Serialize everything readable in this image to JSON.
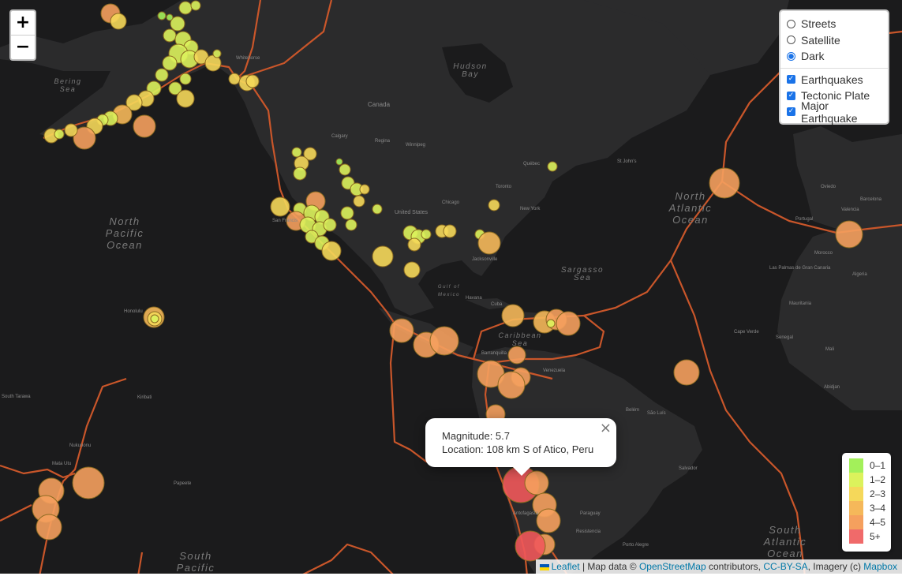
{
  "zoom": {
    "in_label": "+",
    "out_label": "−"
  },
  "layer_control": {
    "base_layers": [
      {
        "label": "Streets",
        "selected": false
      },
      {
        "label": "Satellite",
        "selected": false
      },
      {
        "label": "Dark",
        "selected": true
      }
    ],
    "overlays": [
      {
        "label": "Earthquakes",
        "checked": true
      },
      {
        "label": "Tectonic Plate",
        "checked": true
      },
      {
        "label": "Major Earthquake",
        "checked": true
      }
    ],
    "check_glyph": "✓"
  },
  "legend": {
    "items": [
      {
        "label": "0–1",
        "color": "#a3f05a"
      },
      {
        "label": "1–2",
        "color": "#dcf25c"
      },
      {
        "label": "2–3",
        "color": "#f5d85a"
      },
      {
        "label": "3–4",
        "color": "#f5b85a"
      },
      {
        "label": "4–5",
        "color": "#f5a05e"
      },
      {
        "label": "5+",
        "color": "#f06a6a"
      }
    ]
  },
  "popup": {
    "magnitude_line": "Magnitude: 5.7",
    "location_line": "Location: 108 km S of Atico, Peru",
    "close_glyph": "×"
  },
  "attribution": {
    "leaflet": "Leaflet",
    "sep1": " | Map data © ",
    "osm": "OpenStreetMap",
    "contributors": " contributors, ",
    "license": "CC-BY-SA",
    "imagery": ", Imagery (c) ",
    "mapbox": "Mapbox"
  },
  "map_labels": {
    "north_pacific": [
      "North",
      "Pacific",
      "Ocean"
    ],
    "north_atlantic": [
      "North",
      "Atlantic",
      "Ocean"
    ],
    "south_pacific": [
      "South",
      "Pacific"
    ],
    "south_atlantic": [
      "South",
      "Atlantic",
      "Ocean"
    ],
    "bering_sea": [
      "Bering",
      "Sea"
    ],
    "hudson_bay": [
      "Hudson",
      "Bay"
    ],
    "sargasso_sea": [
      "Sargasso",
      "Sea"
    ],
    "caribbean_sea": "Caribbean Sea",
    "gulf_of_mexico": [
      "Gulf of",
      "Mexico"
    ],
    "canada": "Canada",
    "united_states": "United States",
    "mexico": "Mexico",
    "cities": {
      "honolulu": "Honolulu",
      "whitehorse": "Whitehorse",
      "calgary": "Calgary",
      "regina": "Regina",
      "winnipeg": "Winnipeg",
      "chicago": "Chicago",
      "toronto": "Toronto",
      "new_york": "New York",
      "quebec": "Québec",
      "jacksonville": "Jacksonville",
      "havana": "Havana",
      "cuba": "Cuba",
      "san_francisco": "San Francis",
      "st_johns": "St John's",
      "barranquilla": "Barranquilla",
      "venezuela": "Venezuela",
      "colombia": "Colombia",
      "belem": "Belém",
      "sao_luis": "São Luís",
      "salvador": "Salvador",
      "paraguay": "Paraguay",
      "porto_alegre": "Porto Alegre",
      "resistencia": "Resistencia",
      "antofagasta": "Antofagasta",
      "lagos": "Abidjan",
      "algeria": "Algeria",
      "morocco": "Morocco",
      "las_palmas": "Las Palmas de Gran Canaria",
      "senegal": "Senegal",
      "mauritania": "Mauritania",
      "mali": "Mali",
      "cape_verde": "Cape Verde",
      "valencia": "Valencia",
      "barcelona": "Barcelona",
      "portugal": "Portugal",
      "oviedo": "Oviedo",
      "papeete": "Papeete",
      "nukuoro": "Nukunonu",
      "mata_utu": "Mata Utu",
      "south_tarawa": "South Tarawa",
      "kiribati": "Kiribati"
    }
  }
}
